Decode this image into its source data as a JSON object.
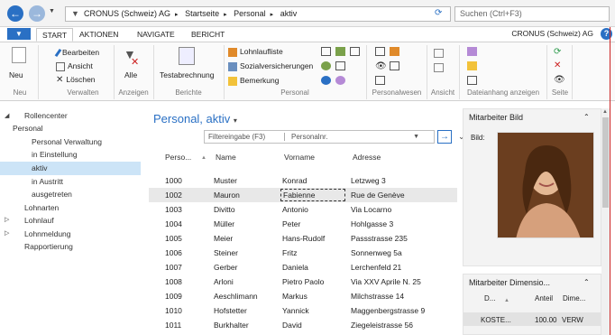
{
  "topbar": {
    "breadcrumb": [
      "CRONUS (Schweiz) AG",
      "Startseite",
      "Personal",
      "aktiv"
    ],
    "search_placeholder": "Suchen (Ctrl+F3)"
  },
  "tabs": [
    "START",
    "AKTIONEN",
    "NAVIGATE",
    "BERICHT"
  ],
  "company": "CRONUS (Schweiz) AG",
  "ribbon": {
    "neu": "Neu",
    "bearbeiten": "Bearbeiten",
    "ansicht": "Ansicht",
    "loeschen": "Löschen",
    "alle": "Alle",
    "testabrechnung": "Testabrechnung",
    "lohnlaufliste": "Lohnlaufliste",
    "sozialversicherungen": "Sozialversicherungen",
    "bemerkung": "Bemerkung",
    "groups": [
      "Neu",
      "Verwalten",
      "Anzeigen",
      "Berichte",
      "Personal",
      "Personalwesen",
      "Ansicht",
      "Dateianhang anzeigen",
      "Seite"
    ]
  },
  "nav": [
    "Rollencenter",
    "Personal",
    "Personal Verwaltung",
    "in Einstellung",
    "aktiv",
    "in Austritt",
    "ausgetreten",
    "Lohnarten",
    "Lohnlauf",
    "Lohnmeldung",
    "Rapportierung"
  ],
  "page_title": "Personal, aktiv",
  "filter": {
    "label": "Filtereingabe (F3)",
    "field": "Personalnr."
  },
  "table": {
    "headers": [
      "Perso...",
      "Name",
      "Vorname",
      "Adresse"
    ],
    "rows": [
      [
        "1000",
        "Muster",
        "Konrad",
        "Letzweg 3"
      ],
      [
        "1002",
        "Mauron",
        "Fabienne",
        "Rue de Genève"
      ],
      [
        "1003",
        "Divitto",
        "Antonio",
        "Via Locarno"
      ],
      [
        "1004",
        "Müller",
        "Peter",
        "Hohlgasse 3"
      ],
      [
        "1005",
        "Meier",
        "Hans-Rudolf",
        "Passstrasse 235"
      ],
      [
        "1006",
        "Steiner",
        "Fritz",
        "Sonnenweg 5a"
      ],
      [
        "1007",
        "Gerber",
        "Daniela",
        "Lerchenfeld 21"
      ],
      [
        "1008",
        "Arloni",
        "Pietro Paolo",
        "Via XXV Aprile N. 25"
      ],
      [
        "1009",
        "Aeschlimann",
        "Markus",
        "Milchstrasse 14"
      ],
      [
        "1010",
        "Hofstetter",
        "Yannick",
        "Maggenbergstrasse 9"
      ],
      [
        "1011",
        "Burkhalter",
        "David",
        "Ziegeleistrasse 56"
      ]
    ]
  },
  "pane1": {
    "title": "Mitarbeiter Bild",
    "label": "Bild:"
  },
  "pane2": {
    "title": "Mitarbeiter Dimensio...",
    "headers": [
      "D...",
      "Anteil",
      "Dime..."
    ],
    "row": [
      "KOSTE...",
      "100.00",
      "VERW"
    ]
  }
}
